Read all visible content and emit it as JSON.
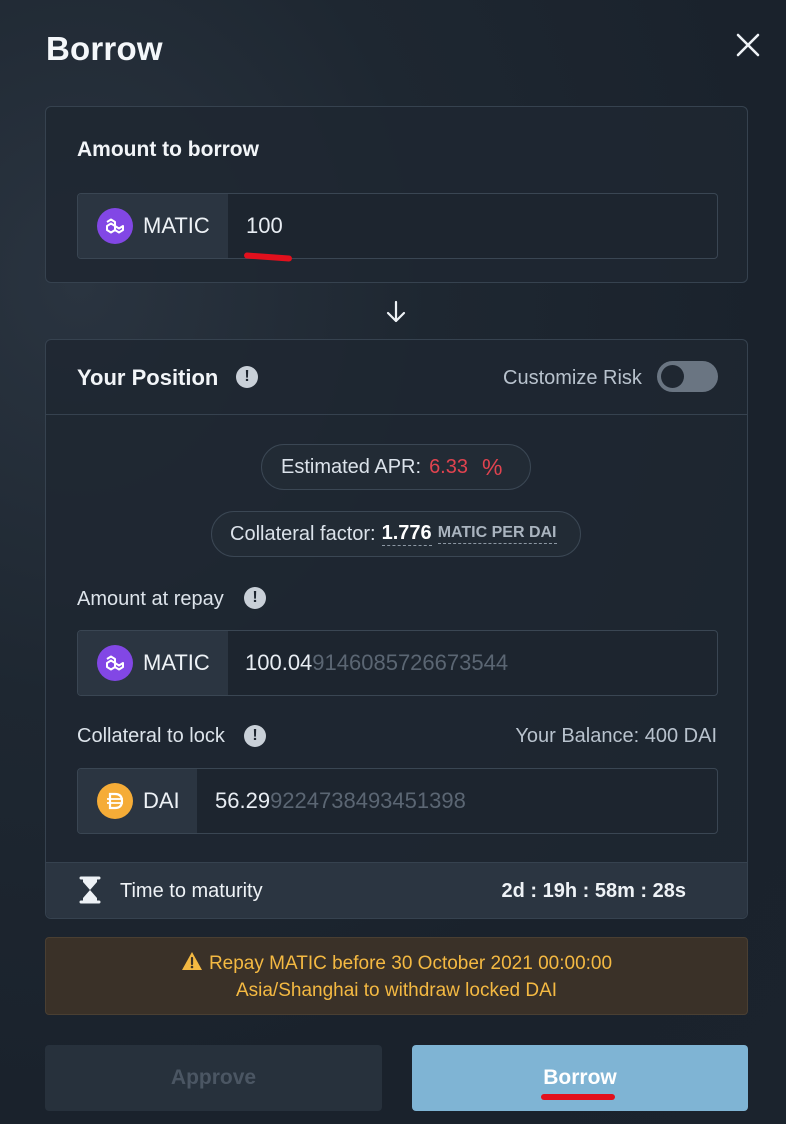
{
  "modal": {
    "title": "Borrow"
  },
  "amount": {
    "label": "Amount to borrow",
    "token": "MATIC",
    "value": "100"
  },
  "position": {
    "title": "Your Position",
    "customize_label": "Customize Risk",
    "customize_enabled": false,
    "apr_label": "Estimated APR:",
    "apr_value": "6.33",
    "apr_unit": "%",
    "collateral_factor_label": "Collateral factor:",
    "collateral_factor_value": "1.776",
    "collateral_factor_unit": "MATIC PER DAI",
    "repay_label": "Amount at repay",
    "repay_token": "MATIC",
    "repay_value_main": "100.04",
    "repay_value_rest": "9146085726673544",
    "collateral_label": "Collateral to lock",
    "balance_text": "Your Balance: 400 DAI",
    "collateral_token": "DAI",
    "collateral_value_main": "56.29",
    "collateral_value_rest": "9224738493451398",
    "maturity_label": "Time to maturity",
    "maturity_value": "2d : 19h : 58m : 28s"
  },
  "warning": {
    "line1": "Repay MATIC before 30 October 2021 00:00:00",
    "line2": "Asia/Shanghai to withdraw locked DAI"
  },
  "buttons": {
    "approve": "Approve",
    "borrow": "Borrow"
  },
  "colors": {
    "accent_borrow": "#7fb4d4",
    "apr_red": "#e0434f",
    "warning_text": "#f4b942",
    "matic_purple": "#8247e5",
    "dai_yellow": "#f5ac37"
  },
  "icons": [
    "close-icon",
    "matic-icon",
    "arrow-down-icon",
    "info-icon",
    "dai-icon",
    "hourglass-icon",
    "warning-icon"
  ]
}
